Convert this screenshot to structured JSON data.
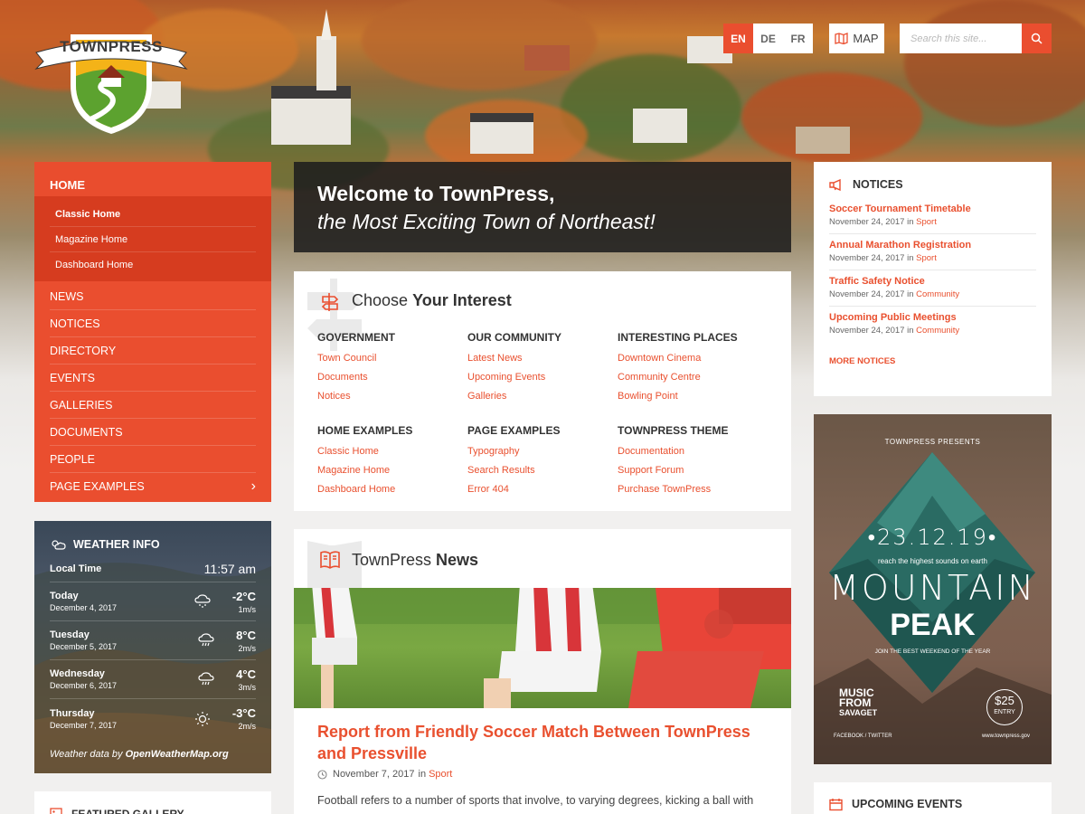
{
  "brand": {
    "name": "TOWNPRESS",
    "accent": "#ea4e2f"
  },
  "header": {
    "languages": [
      {
        "code": "EN",
        "active": true
      },
      {
        "code": "DE",
        "active": false
      },
      {
        "code": "FR",
        "active": false
      }
    ],
    "map_label": "MAP",
    "search_placeholder": "Search this site...",
    "search_icon": "search-icon"
  },
  "nav": {
    "home": "HOME",
    "home_sub": [
      "Classic Home",
      "Magazine Home",
      "Dashboard Home"
    ],
    "items": [
      "NEWS",
      "NOTICES",
      "DIRECTORY",
      "EVENTS",
      "GALLERIES",
      "DOCUMENTS",
      "PEOPLE",
      "PAGE EXAMPLES"
    ],
    "submenu_arrow": "›"
  },
  "weather": {
    "title": "WEATHER INFO",
    "local_time_label": "Local Time",
    "local_time": "11:57 am",
    "days": [
      {
        "day": "Today",
        "date": "December 4, 2017",
        "temp": "-2°C",
        "wind": "1m/s",
        "icon": "snow-cloud-icon"
      },
      {
        "day": "Tuesday",
        "date": "December 5, 2017",
        "temp": "8°C",
        "wind": "2m/s",
        "icon": "rain-cloud-icon"
      },
      {
        "day": "Wednesday",
        "date": "December 6, 2017",
        "temp": "4°C",
        "wind": "3m/s",
        "icon": "rain-cloud-icon"
      },
      {
        "day": "Thursday",
        "date": "December 7, 2017",
        "temp": "-3°C",
        "wind": "2m/s",
        "icon": "sun-icon"
      }
    ],
    "credit_prefix": "Weather data by",
    "credit_source": "OpenWeatherMap.org"
  },
  "featured_gallery": {
    "title": "FEATURED GALLERY"
  },
  "welcome": {
    "line1": "Welcome to TownPress,",
    "line2": "the Most Exciting Town of Northeast!"
  },
  "interest": {
    "title_light": "Choose",
    "title_bold": "Your Interest",
    "columns": [
      {
        "heading": "GOVERNMENT",
        "links": [
          "Town Council",
          "Documents",
          "Notices"
        ]
      },
      {
        "heading": "OUR COMMUNITY",
        "links": [
          "Latest News",
          "Upcoming Events",
          "Galleries"
        ]
      },
      {
        "heading": "INTERESTING PLACES",
        "links": [
          "Downtown Cinema",
          "Community Centre",
          "Bowling Point"
        ]
      },
      {
        "heading": "HOME EXAMPLES",
        "links": [
          "Classic Home",
          "Magazine Home",
          "Dashboard Home"
        ]
      },
      {
        "heading": "PAGE EXAMPLES",
        "links": [
          "Typography",
          "Search Results",
          "Error 404"
        ]
      },
      {
        "heading": "TOWNPRESS THEME",
        "links": [
          "Documentation",
          "Support Forum",
          "Purchase TownPress"
        ]
      }
    ]
  },
  "news": {
    "title_light": "TownPress",
    "title_bold": "News",
    "headline": "Report from Friendly Soccer Match Between TownPress and Pressville",
    "date": "November 7, 2017",
    "in_label": "in",
    "category": "Sport",
    "excerpt": "Football refers to a number of sports that involve, to varying degrees, kicking a ball with"
  },
  "notices": {
    "title": "NOTICES",
    "in_label": "in",
    "items": [
      {
        "title": "Soccer Tournament Timetable",
        "date": "November 24, 2017",
        "category": "Sport"
      },
      {
        "title": "Annual Marathon Registration",
        "date": "November 24, 2017",
        "category": "Sport"
      },
      {
        "title": "Traffic Safety Notice",
        "date": "November 24, 2017",
        "category": "Community"
      },
      {
        "title": "Upcoming Public Meetings",
        "date": "November 24, 2017",
        "category": "Community"
      }
    ],
    "more": "MORE NOTICES"
  },
  "poster": {
    "presents": "TOWNPRESS PRESENTS",
    "date": "•23.12.19•",
    "tagline": "reach the highest sounds on earth",
    "word1": "MOUNTAIN",
    "word2": "PEAK",
    "join": "JOIN THE BEST WEEKEND OF THE YEAR",
    "music": [
      "MUSIC",
      "FROM",
      "SAVAGET"
    ],
    "price": "$25",
    "entry": "ENTRY",
    "social": "FACEBOOK / TWITTER",
    "site": "www.townpress.gov"
  },
  "upcoming": {
    "title": "UPCOMING EVENTS"
  }
}
